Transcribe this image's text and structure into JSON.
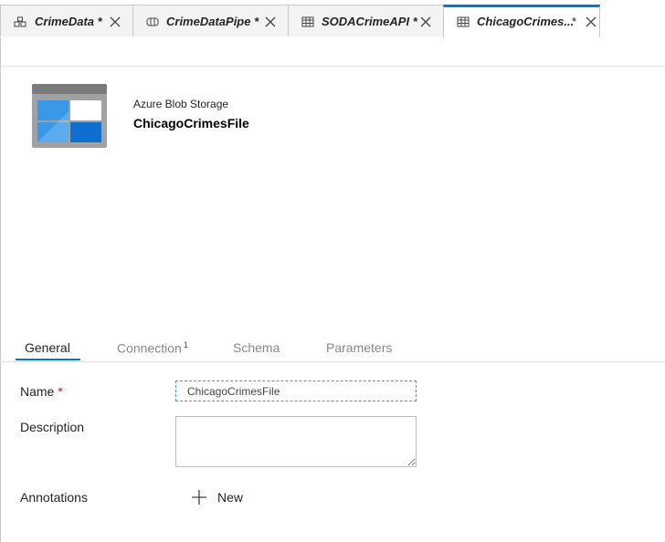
{
  "tabs": [
    {
      "label": "CrimeData",
      "modified": "*",
      "icon": "pipeline-icon"
    },
    {
      "label": "CrimeDataPipe",
      "modified": "*",
      "icon": "dataflow-icon"
    },
    {
      "label": "SODACrimeAPI",
      "modified": "*",
      "icon": "dataset-table-icon"
    },
    {
      "label": "ChicagoCrimes...",
      "modified": "*",
      "icon": "dataset-table-icon"
    }
  ],
  "header": {
    "subtitle": "Azure Blob Storage",
    "title": "ChicagoCrimesFile",
    "icon": "azure-blob-storage-icon"
  },
  "inner_tabs": [
    {
      "label": "General"
    },
    {
      "label": "Connection",
      "badge": "1"
    },
    {
      "label": "Schema"
    },
    {
      "label": "Parameters"
    }
  ],
  "form": {
    "name_label": "Name",
    "required_marker": "*",
    "name_value": "ChicagoCrimesFile",
    "description_label": "Description",
    "description_value": "",
    "annotations_label": "Annotations",
    "new_label": "New"
  },
  "colors": {
    "accent": "#0078d4",
    "required": "#a4262c"
  }
}
